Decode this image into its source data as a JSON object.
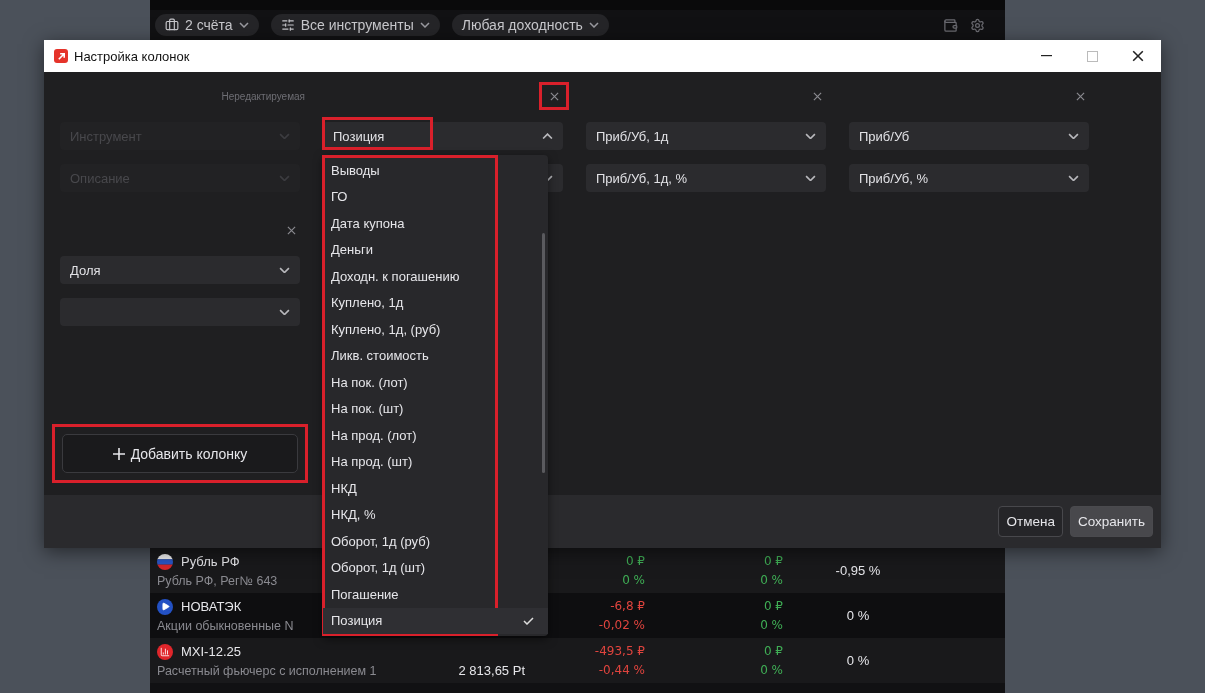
{
  "app": {
    "filters": [
      {
        "kind": "accounts",
        "label": "2 счёта"
      },
      {
        "kind": "instruments",
        "label": "Все инструменты"
      },
      {
        "kind": "yield",
        "label": "Любая доходность"
      }
    ],
    "rows": [
      {
        "kind": "flag",
        "name": "Рубль РФ",
        "description": "Рубль РФ, Рег№ 643",
        "price": "",
        "change": [
          {
            "text": "0 ₽",
            "color": "#3fae55"
          },
          {
            "text": "0 %",
            "color": "#3fae55"
          }
        ],
        "position_change": [
          {
            "text": "0 ₽",
            "color": "#3fae55"
          },
          {
            "text": "0 %",
            "color": "#3fae55"
          }
        ],
        "share": "-0,95 %"
      },
      {
        "kind": "play",
        "name": "НОВАТЭК",
        "description": "Акции обыкновенные N",
        "price": "",
        "change": [
          {
            "text": "-6,8 ₽",
            "color": "#e0443e"
          },
          {
            "text": "-0,02 %",
            "color": "#e0443e"
          }
        ],
        "position_change": [
          {
            "text": "0 ₽",
            "color": "#3fae55"
          },
          {
            "text": "0 %",
            "color": "#3fae55"
          }
        ],
        "share": "0 %"
      },
      {
        "kind": "chart",
        "name": "MXI-12.25",
        "description": "Расчетный фьючерс с исполнением 1",
        "price": "2 813,65 Pt",
        "change": [
          {
            "text": "-493,5 ₽",
            "color": "#e0443e"
          },
          {
            "text": "-0,44 %",
            "color": "#e0443e"
          }
        ],
        "position_change": [
          {
            "text": "0 ₽",
            "color": "#3fae55"
          },
          {
            "text": "0 %",
            "color": "#3fae55"
          }
        ],
        "share": "0 %"
      }
    ]
  },
  "dialog": {
    "title": "Настройка колонок",
    "columns": [
      {
        "header": "Нередактируемая",
        "editable": false,
        "fields": [
          {
            "value": "Инструмент",
            "open": false
          },
          {
            "value": "Описание",
            "open": false
          }
        ]
      },
      {
        "editable": true,
        "remove_highlighted": true,
        "fields": [
          {
            "value": "Позиция",
            "open": true,
            "highlighted": true
          },
          {
            "open": false
          }
        ]
      },
      {
        "editable": true,
        "remove_highlighted": false,
        "fields": [
          {
            "value": "Приб/Уб, 1д",
            "open": false
          },
          {
            "value": "Приб/Уб, 1д, %",
            "open": false
          }
        ]
      },
      {
        "editable": true,
        "remove_highlighted": false,
        "fields": [
          {
            "value": "Приб/Уб",
            "open": false
          },
          {
            "value": "Приб/Уб, %",
            "open": false
          }
        ]
      },
      {
        "editable": true,
        "remove_highlighted": false,
        "fields": [
          {
            "value": "Доля",
            "open": false
          },
          {
            "open": false
          }
        ]
      }
    ],
    "dropdown": {
      "highlighted": true,
      "items": [
        {
          "label": "Выводы",
          "selected": false
        },
        {
          "label": "ГО",
          "selected": false
        },
        {
          "label": "Дата купона",
          "selected": false
        },
        {
          "label": "Деньги",
          "selected": false
        },
        {
          "label": "Доходн. к погашению",
          "selected": false
        },
        {
          "label": "Куплено, 1д",
          "selected": false
        },
        {
          "label": "Куплено, 1д, (руб)",
          "selected": false
        },
        {
          "label": "Ликв. стоимость",
          "selected": false
        },
        {
          "label": "На пок. (лот)",
          "selected": false
        },
        {
          "label": "На пок. (шт)",
          "selected": false
        },
        {
          "label": "На прод. (лот)",
          "selected": false
        },
        {
          "label": "На прод. (шт)",
          "selected": false
        },
        {
          "label": "НКД",
          "selected": false
        },
        {
          "label": "НКД, %",
          "selected": false
        },
        {
          "label": "Оборот, 1д (руб)",
          "selected": false
        },
        {
          "label": "Оборот, 1д (шт)",
          "selected": false
        },
        {
          "label": "Погашение",
          "selected": false
        },
        {
          "label": "Позиция",
          "selected": true
        }
      ]
    },
    "add_button": {
      "label": "Добавить колонку",
      "highlighted": true
    },
    "buttons": [
      {
        "kind": "secondary",
        "label": "Отмена"
      },
      {
        "kind": "primary",
        "label": "Сохранить"
      }
    ]
  }
}
